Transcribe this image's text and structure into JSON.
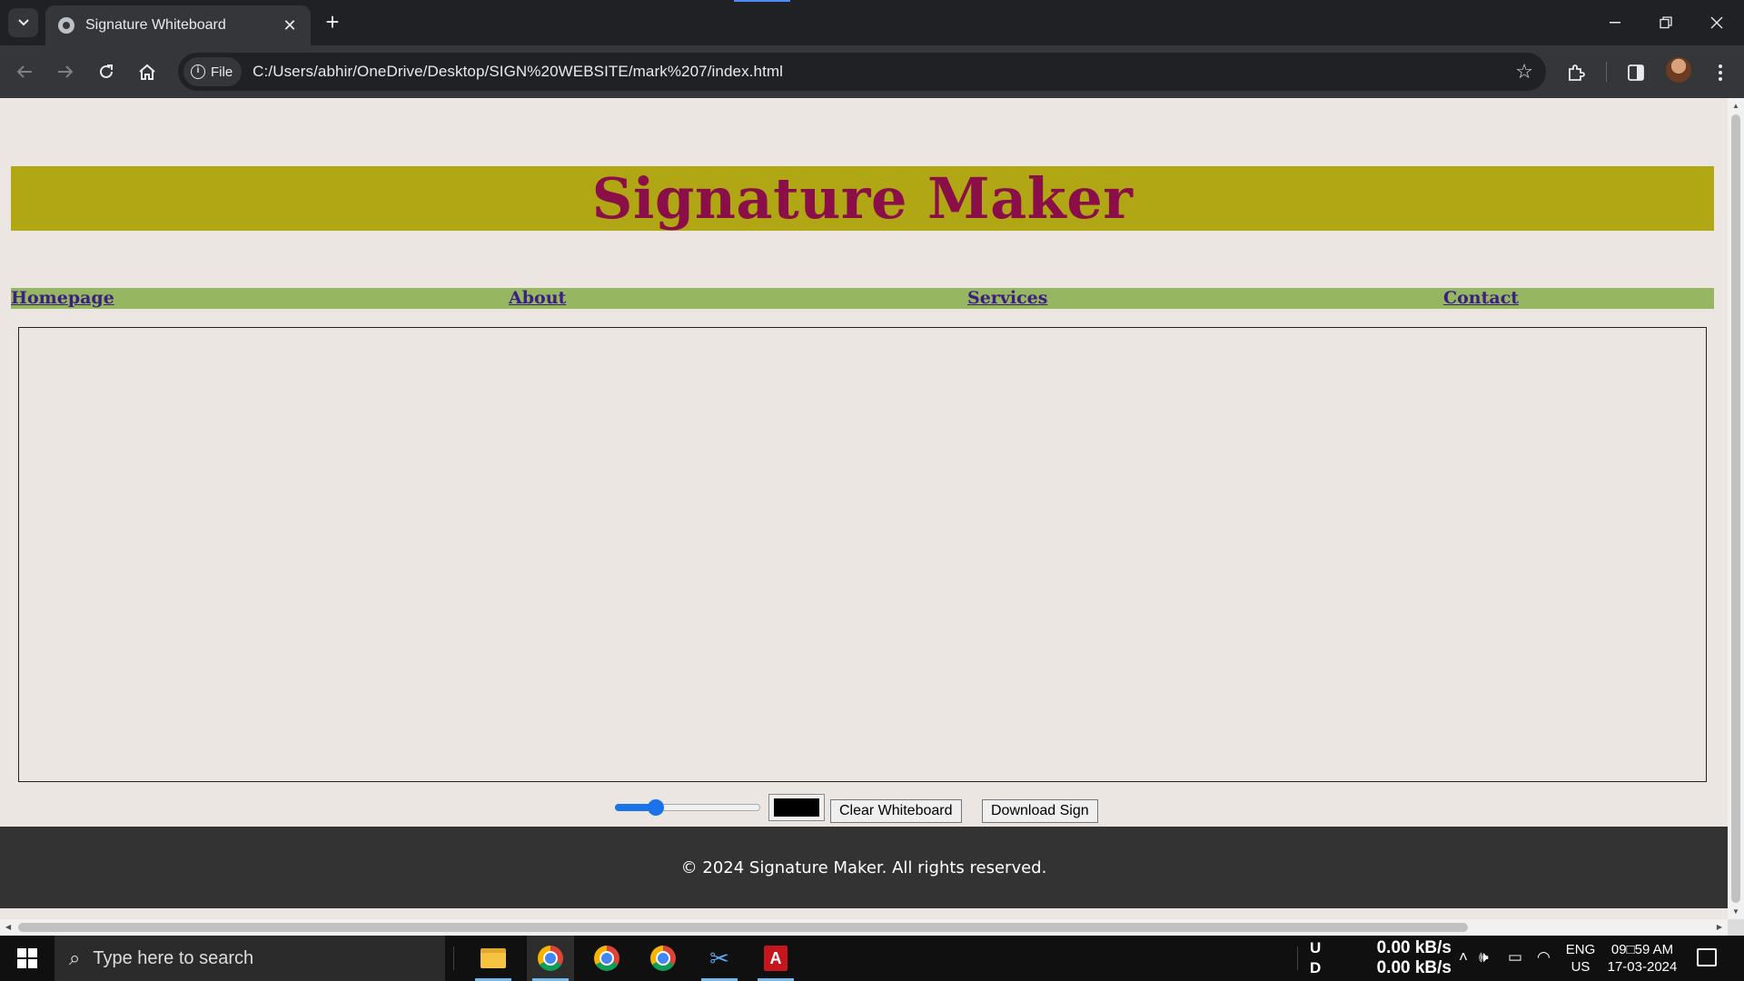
{
  "browser": {
    "tab_title": "Signature Whiteboard",
    "address_chip": "File",
    "url": "C:/Users/abhir/OneDrive/Desktop/SIGN%20WEBSITE/mark%207/index.html"
  },
  "page": {
    "title": "Signature Maker",
    "nav": [
      "Homepage",
      "About",
      "Services",
      "Contact"
    ],
    "pen_size_slider": {
      "value": 25,
      "min": 0,
      "max": 100
    },
    "pen_color": "#000000",
    "clear_button": "Clear Whiteboard",
    "download_button": "Download Sign",
    "footer": "© 2024 Signature Maker. All rights reserved."
  },
  "taskbar": {
    "search_placeholder": "Type here to search",
    "net_up_label": "U",
    "net_down_label": "D",
    "net_up_speed": "0.00 kB/s",
    "net_down_speed": "0.00 kB/s",
    "lang_line1": "ENG",
    "lang_line2": "US",
    "time": "09□59 AM",
    "date": "17-03-2024"
  },
  "colors": {
    "banner": "#b1a613",
    "title": "#8a0f48",
    "navbar": "#96b661",
    "nav_link": "#3c2080",
    "page_bg": "#ebe6e1",
    "footer_bg": "#333333"
  }
}
